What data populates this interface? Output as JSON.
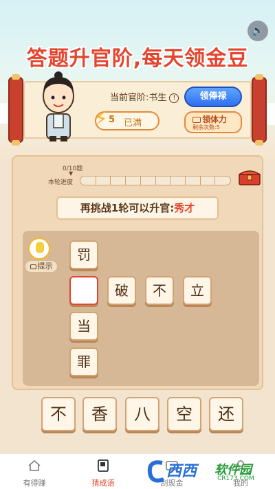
{
  "header": {
    "title": "答题升官阶,每天领金豆",
    "sound_icon": "speaker-icon"
  },
  "profile": {
    "rank_label": "当前官阶:书生",
    "info_icon": "!",
    "energy_value": "5",
    "energy_status": "已满",
    "salary_button": "领俸禄",
    "stamina_button": "领体力",
    "stamina_remaining": "剩余次数:5"
  },
  "progress": {
    "count": "0/10题",
    "label": "本轮进度",
    "segments": 10,
    "current": 0
  },
  "challenge": {
    "prefix": "再挑战1轮可以升官:",
    "next_rank": "秀才"
  },
  "hint": {
    "label": "提示"
  },
  "grid": {
    "vertical": [
      "罚",
      "",
      "当",
      "罪"
    ],
    "horizontal": [
      "破",
      "不",
      "立"
    ]
  },
  "options": [
    "不",
    "香",
    "八",
    "空",
    "还"
  ],
  "tabs": [
    {
      "label": "有得赚",
      "icon": "home-icon"
    },
    {
      "label": "猜成语",
      "icon": "book-icon"
    },
    {
      "label": "刮现金",
      "icon": "card-icon"
    },
    {
      "label": "我的",
      "icon": "user-icon"
    }
  ],
  "watermark": {
    "brand1": "西西",
    "brand2": "软件园",
    "site": "CR173.COM"
  },
  "colors": {
    "accent": "#e4452e",
    "blue_button": "#2f6ff0",
    "board": "#f0d8b8"
  }
}
